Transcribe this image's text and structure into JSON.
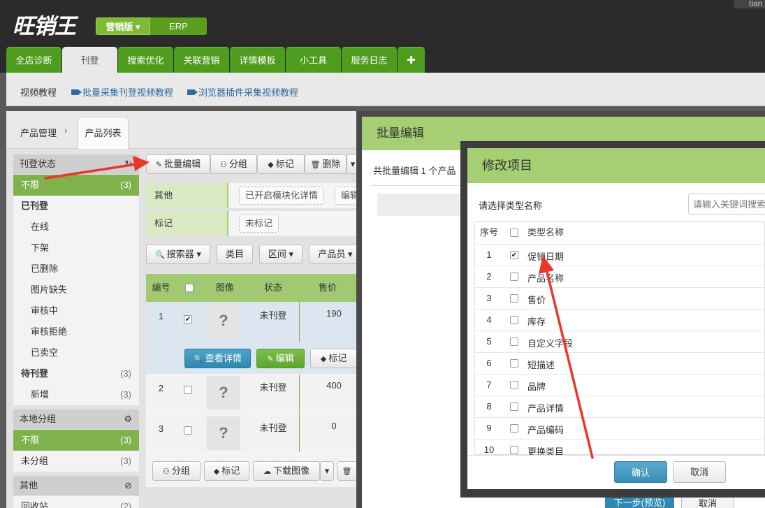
{
  "app": {
    "logo_text": "旺销王",
    "edition_marketing": "营销版 ▾",
    "edition_erp": "ERP",
    "user_label": "tian"
  },
  "nav": {
    "tabs": [
      "全店诊断",
      "刊登",
      "搜索优化",
      "关联营销",
      "详情模板",
      "小工具",
      "服务日志",
      "✚"
    ],
    "active": "刊登"
  },
  "subnav": {
    "label": "视频教程",
    "links": [
      "批量采集刊登视频教程",
      "浏览器插件采集视频教程"
    ]
  },
  "breadcrumb": {
    "parent": "产品管理",
    "separator": "›",
    "current": "产品列表"
  },
  "sidebar": {
    "status_title": "刊登状态",
    "status_icon": "refresh-icon",
    "all": {
      "label": "不限",
      "count": "(3)"
    },
    "published": "已刊登",
    "published_items": [
      "在线",
      "下架",
      "已删除",
      "图片缺失",
      "审核中",
      "审核拒绝",
      "已卖空"
    ],
    "pending": {
      "label": "待刊登",
      "count": "(3)"
    },
    "pending_new": {
      "label": "新增",
      "count": "(3)"
    },
    "group_title": "本地分组",
    "group_all": {
      "label": "不限",
      "count": "(3)"
    },
    "ungrouped": {
      "label": "未分组",
      "count": "(3)"
    },
    "other_title": "其他",
    "recycle": {
      "label": "回收站",
      "count": "(2)"
    }
  },
  "toolbar": {
    "batch_edit": "批量编辑",
    "group": "分组",
    "mark": "标记",
    "delete": "删除"
  },
  "filters": {
    "other_label": "其他",
    "other_tags": [
      "已开启模块化详情",
      "编辑"
    ],
    "mark_label": "标记",
    "mark_tags": [
      "未标记"
    ]
  },
  "search_bar": {
    "searcher": "搜索器",
    "category": "类目",
    "range": "区间",
    "seller": "产品员"
  },
  "table": {
    "headers": [
      "编号",
      "",
      "图像",
      "状态",
      "售价"
    ],
    "rows": [
      {
        "num": "1",
        "checked": true,
        "img": "?",
        "status": "未刊登",
        "price": "190"
      },
      {
        "num": "2",
        "checked": false,
        "img": "?",
        "status": "未刊登",
        "price": "400"
      },
      {
        "num": "3",
        "checked": false,
        "img": "?",
        "status": "未刊登",
        "price": "0"
      }
    ],
    "row_actions": [
      "查看详情",
      "编辑",
      "标记"
    ]
  },
  "bottom_toolbar": {
    "group": "分组",
    "mark": "标记",
    "download": "下载图像",
    "delete": "删"
  },
  "batch_modal": {
    "title": "批量编辑",
    "info": "共批量编辑 1 个产品",
    "next": "下一步(预览)",
    "cancel": "取消"
  },
  "modify_modal": {
    "title": "修改项目",
    "prompt": "请选择类型名称",
    "search_placeholder": "请输入关键词搜索",
    "headers": {
      "num": "序号",
      "name": "类型名称"
    },
    "items": [
      {
        "num": "1",
        "name": "促销日期",
        "checked": true
      },
      {
        "num": "2",
        "name": "产品名称",
        "checked": false
      },
      {
        "num": "3",
        "name": "售价",
        "checked": false
      },
      {
        "num": "4",
        "name": "库存",
        "checked": false
      },
      {
        "num": "5",
        "name": "自定义字段",
        "checked": false
      },
      {
        "num": "6",
        "name": "短描述",
        "checked": false
      },
      {
        "num": "7",
        "name": "品牌",
        "checked": false
      },
      {
        "num": "8",
        "name": "产品详情",
        "checked": false
      },
      {
        "num": "9",
        "name": "产品编码",
        "checked": false
      },
      {
        "num": "10",
        "name": "更换类目",
        "checked": false
      }
    ],
    "ok": "确认",
    "cancel": "取消"
  },
  "colors": {
    "accent_green": "#4e9c1e",
    "header_green": "#a6cf73",
    "primary_blue": "#2f88b0",
    "annotation_red": "#e8372c"
  }
}
